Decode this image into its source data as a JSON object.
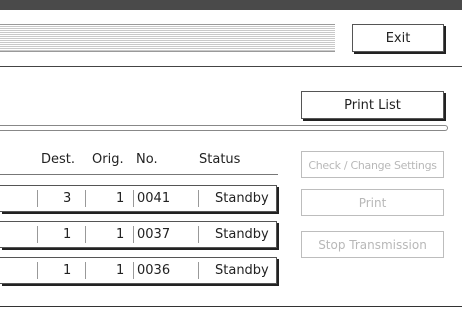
{
  "header": {
    "exit_label": "Exit"
  },
  "actions": {
    "print_list_label": "Print List",
    "check_change_label": "Check / Change Settings",
    "print_label": "Print",
    "stop_label": "Stop Transmission"
  },
  "columns": {
    "dest": "Dest.",
    "orig": "Orig.",
    "no": "No.",
    "status": "Status"
  },
  "rows": [
    {
      "dest": "3",
      "orig": "1",
      "no": "0041",
      "status": "Standby"
    },
    {
      "dest": "1",
      "orig": "1",
      "no": "0037",
      "status": "Standby"
    },
    {
      "dest": "1",
      "orig": "1",
      "no": "0036",
      "status": "Standby"
    }
  ]
}
